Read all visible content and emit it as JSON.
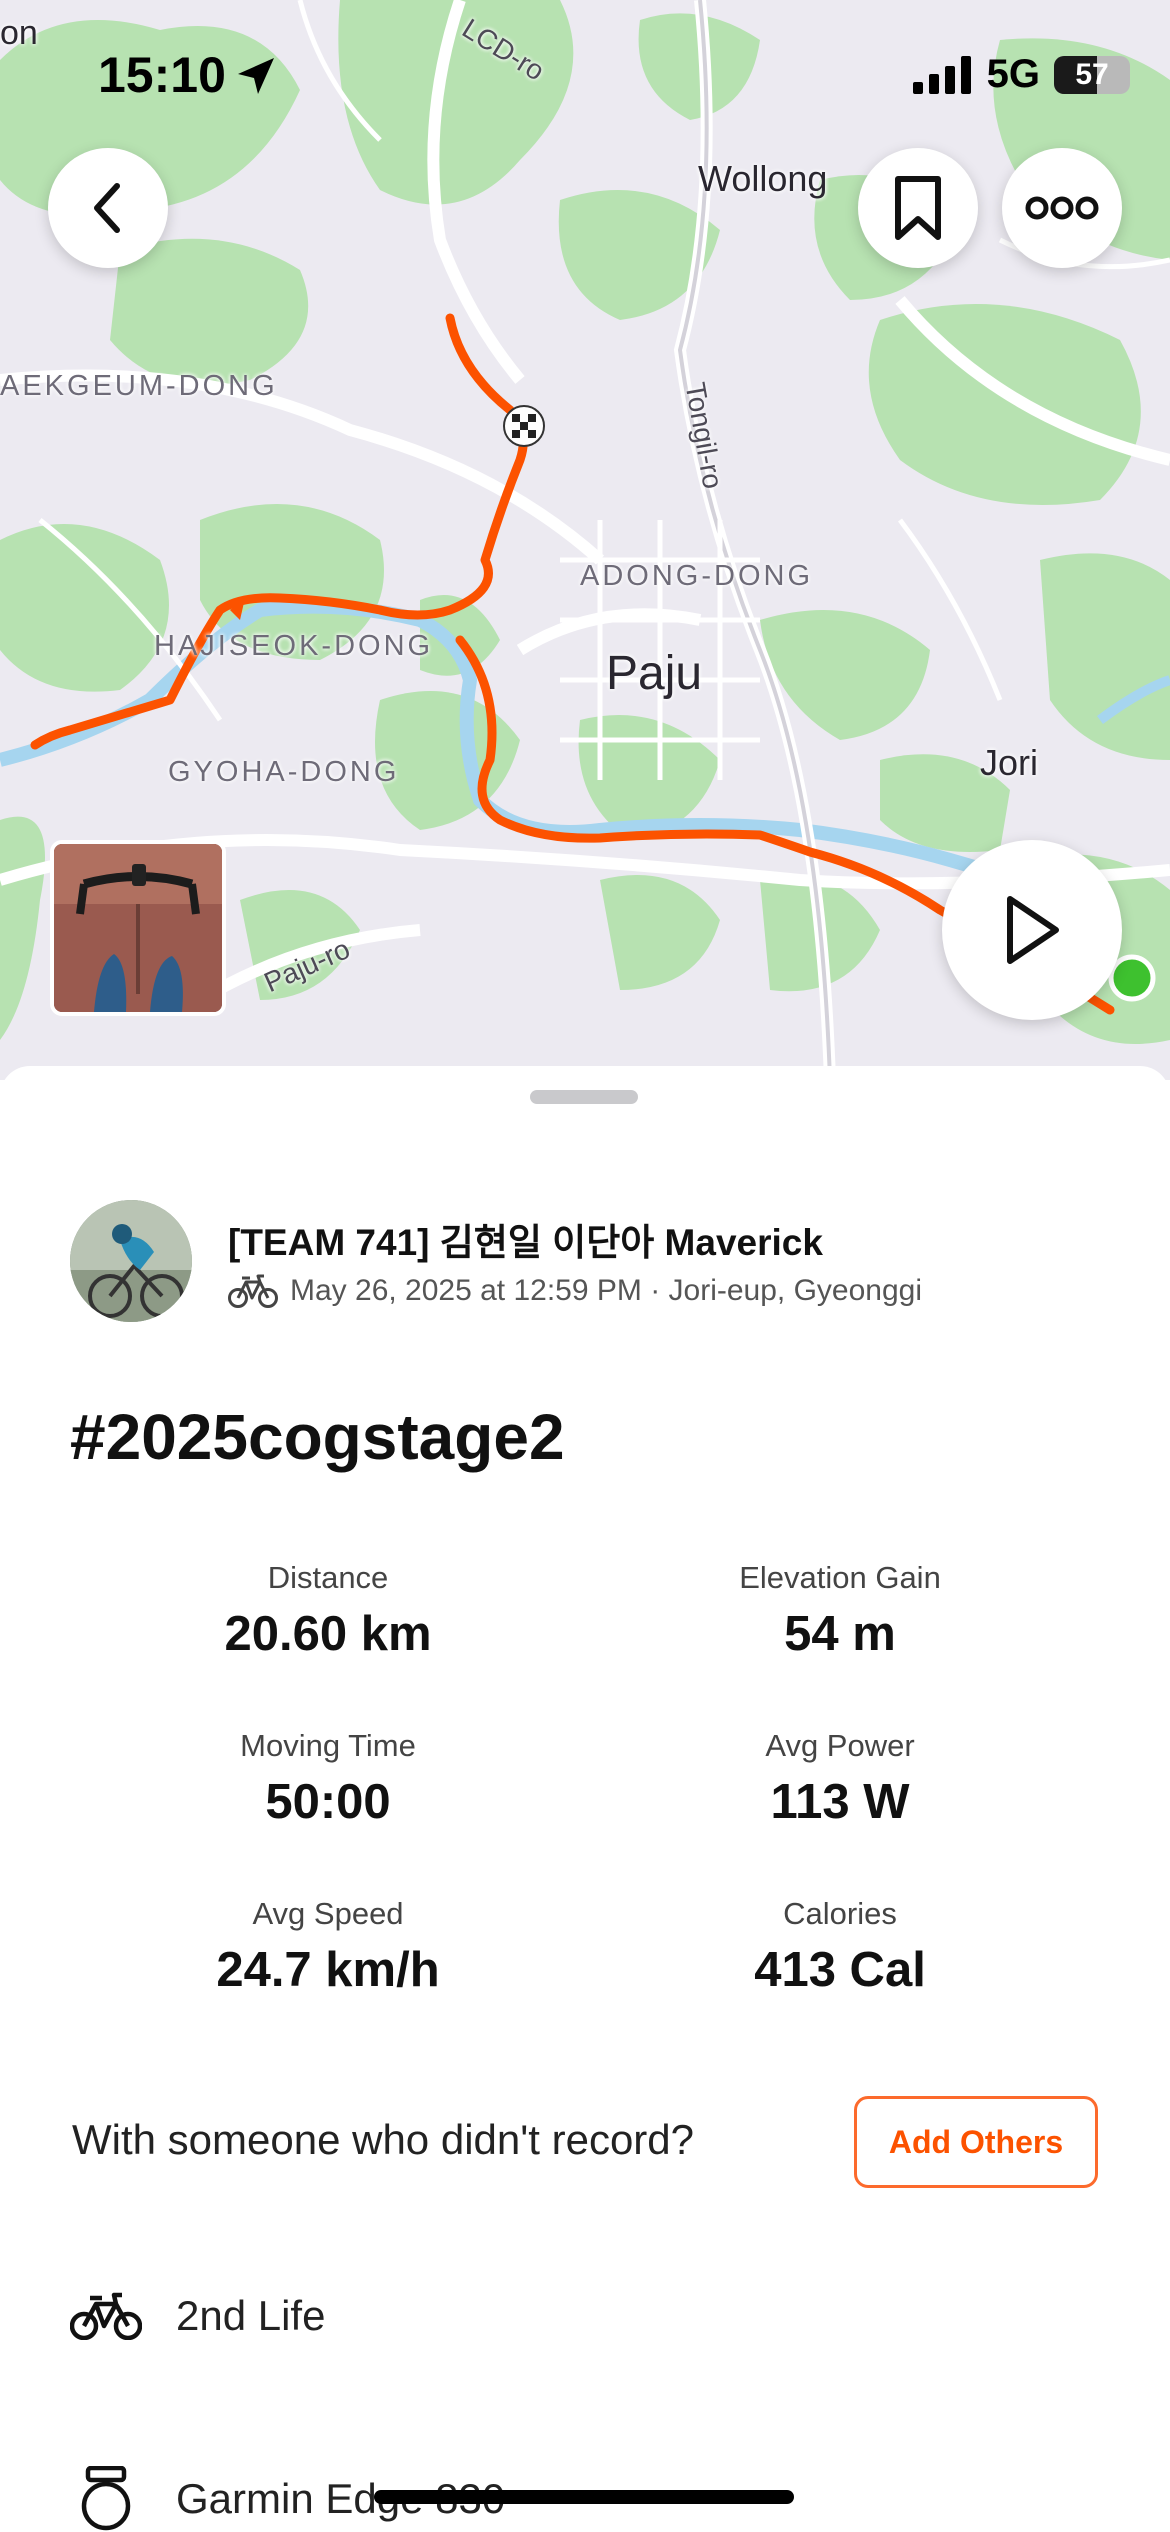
{
  "status_bar": {
    "time": "15:10",
    "network": "5G",
    "battery": "57",
    "battery_level": 0.57
  },
  "map": {
    "labels": {
      "lcd_ro": "LCD-ro",
      "wollong": "Wollong",
      "aekgeum": "AEKGEUM-DONG",
      "tongil_ro": "Tongil-ro",
      "adong": "ADONG-DONG",
      "hajiseok": "HAJISEOK-DONG",
      "paju": "Paju",
      "gyoha": "GYOHA-DONG",
      "jori": "Jori",
      "paju_ro": "Paju-ro",
      "edge_on": "on"
    },
    "route_color": "#fc5200",
    "start_color": "#3ec12f"
  },
  "activity": {
    "athlete_name": "[TEAM 741] 김현일 이단아 Maverick",
    "meta": "May 26, 2025 at 12:59 PM · Jori-eup, Gyeonggi",
    "title": "#2025cogstage2"
  },
  "stats": [
    {
      "label": "Distance",
      "value": "20.60 km"
    },
    {
      "label": "Elevation Gain",
      "value": "54 m"
    },
    {
      "label": "Moving Time",
      "value": "50:00"
    },
    {
      "label": "Avg Power",
      "value": "113 W"
    },
    {
      "label": "Avg Speed",
      "value": "24.7 km/h"
    },
    {
      "label": "Calories",
      "value": "413 Cal"
    }
  ],
  "with_others": {
    "prompt": "With someone who didn't record?",
    "button": "Add Others"
  },
  "gear": [
    {
      "icon": "bike-icon",
      "label": "2nd Life"
    },
    {
      "icon": "watch-icon",
      "label": "Garmin Edge 830"
    }
  ],
  "colors": {
    "accent": "#fc5200",
    "map_water": "#9fd2ee",
    "map_green": "#b4e3b0"
  }
}
